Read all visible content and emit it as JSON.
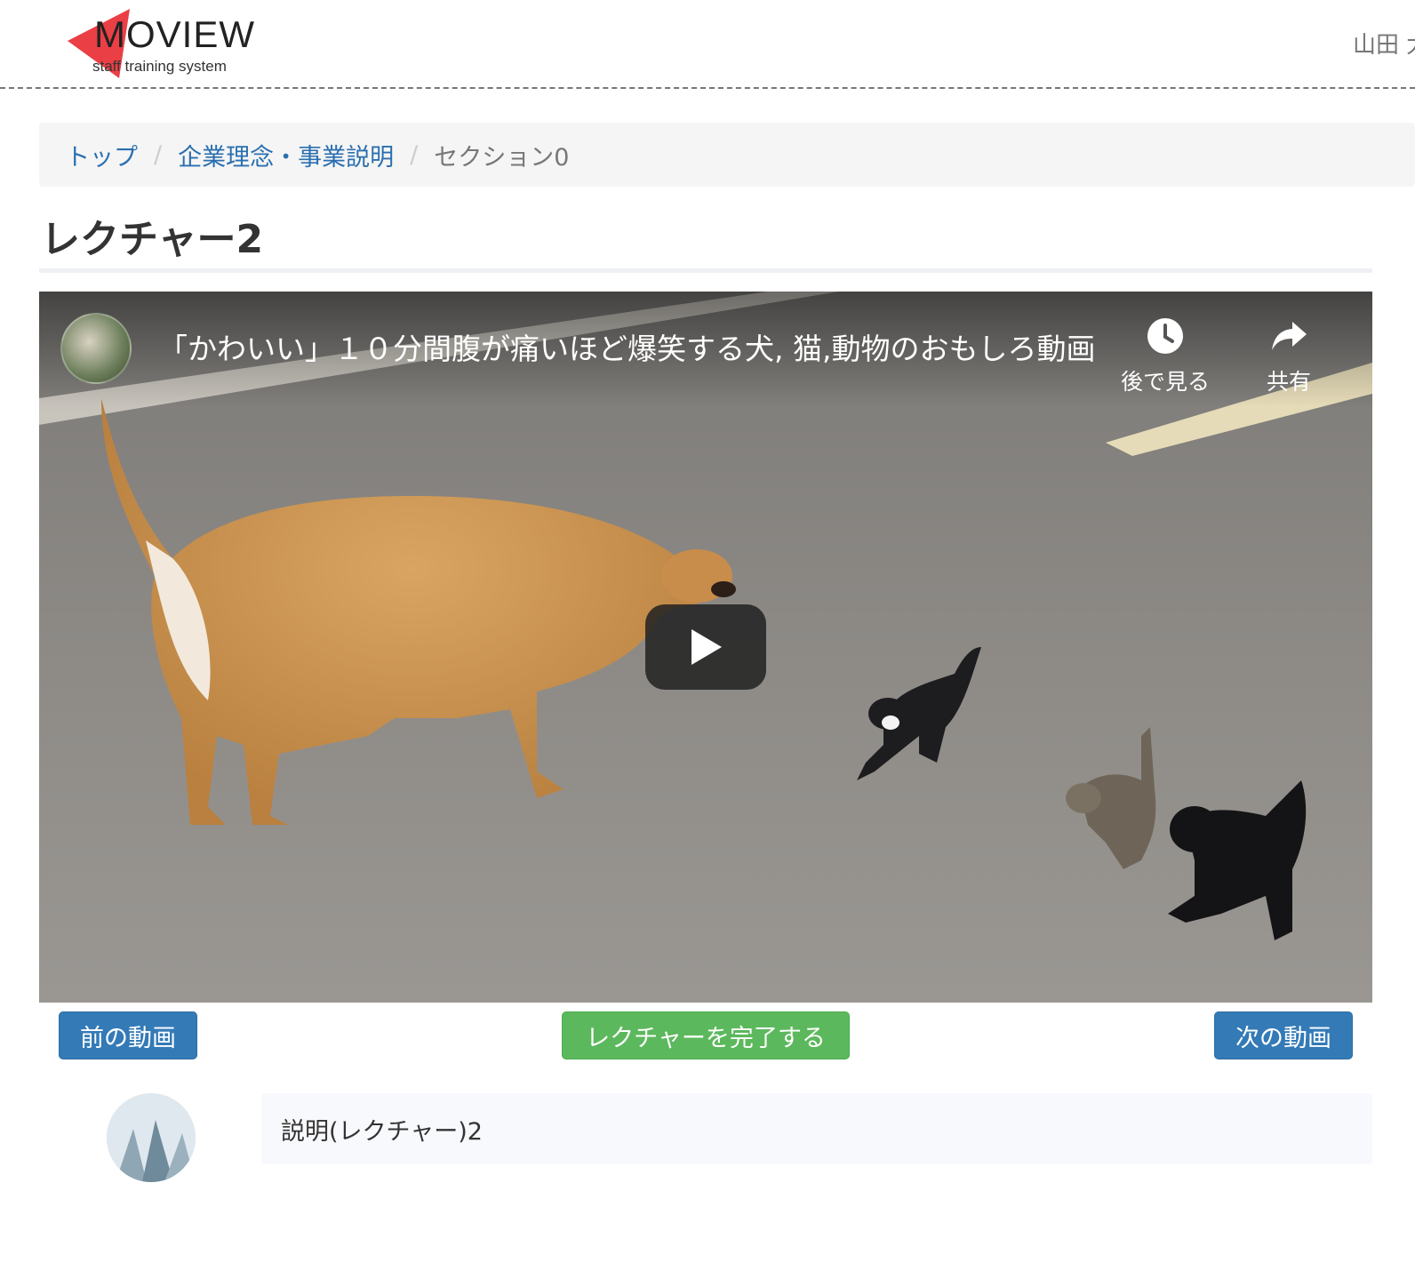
{
  "header": {
    "logo_text": "MOVIEW",
    "logo_subtitle": "staff training system",
    "user_name": "山田 太",
    "logo_color": "#e8383d"
  },
  "breadcrumb": {
    "items": [
      {
        "label": "トップ"
      },
      {
        "label": "企業理念・事業説明"
      },
      {
        "label": "セクション0"
      }
    ],
    "separator": "/"
  },
  "page": {
    "title": "レクチャー2"
  },
  "video": {
    "title": "「かわいい」１０分間腹が痛いほど爆笑する犬, 猫,動物のおもしろ動画",
    "watch_later_label": "後で見る",
    "share_label": "共有",
    "icons": {
      "watch_later": "clock-icon",
      "share": "share-arrow-icon",
      "play": "play-icon"
    }
  },
  "controls": {
    "prev_label": "前の動画",
    "complete_label": "レクチャーを完了する",
    "next_label": "次の動画",
    "primary_color": "#337ab7",
    "success_color": "#5cb85c"
  },
  "description": {
    "text": "説明(レクチャー)2"
  }
}
